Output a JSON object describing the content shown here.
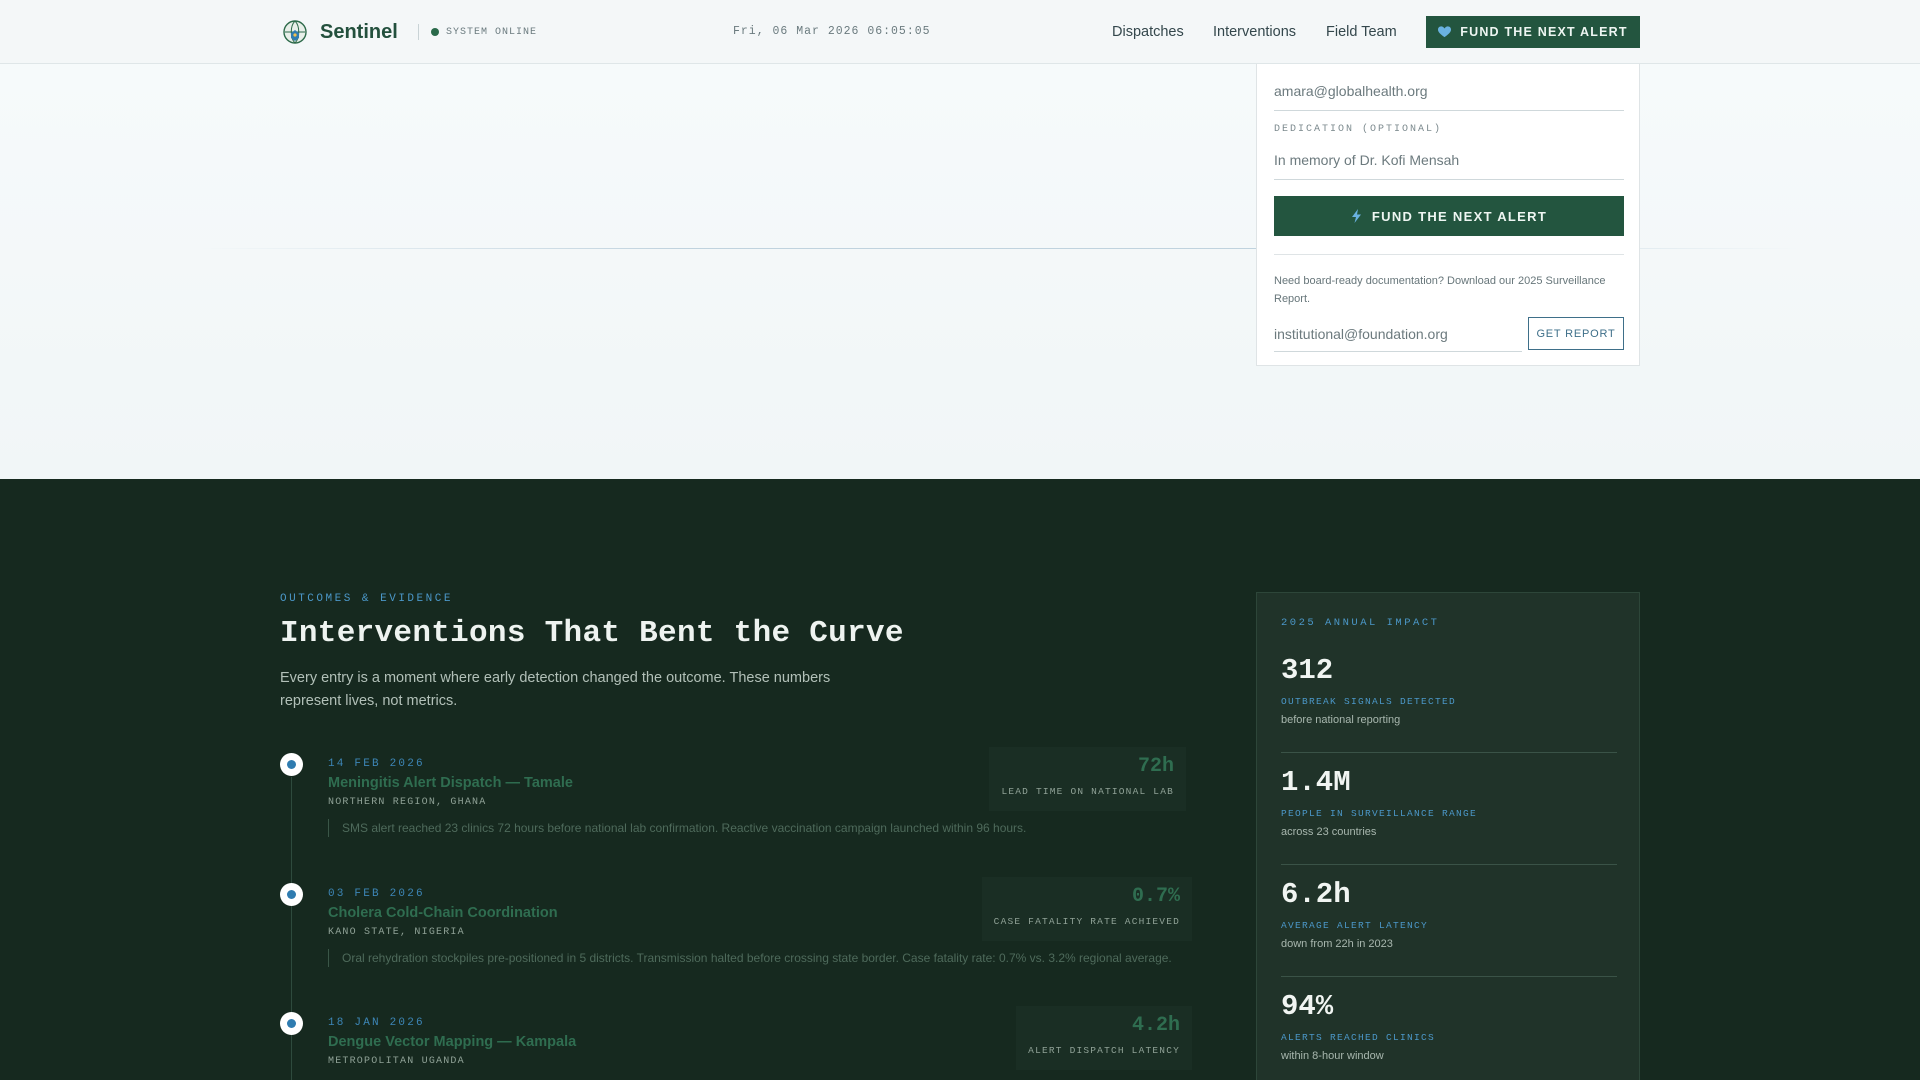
{
  "header": {
    "brand": "Sentinel",
    "status": "SYSTEM ONLINE",
    "clock": "Fri, 06 Mar 2026 06:05:05",
    "nav": [
      "Dispatches",
      "Interventions",
      "Field Team"
    ],
    "cta_label": "FUND THE NEXT ALERT"
  },
  "donation_form": {
    "email_value": "amara@globalhealth.org",
    "dedication_label": "DEDICATION (OPTIONAL)",
    "dedication_value": "In memory of Dr. Kofi Mensah",
    "submit_label": "FUND THE NEXT ALERT",
    "report_note": "Need board-ready documentation? Download our 2025 Surveillance Report.",
    "report_email_value": "institutional@foundation.org",
    "report_button": "GET REPORT"
  },
  "outcomes": {
    "eyebrow": "OUTCOMES & EVIDENCE",
    "title": "Interventions That Bent the Curve",
    "description": "Every entry is a moment where early detection changed the outcome. These numbers represent lives, not metrics.",
    "timeline": [
      {
        "date": "14 FEB 2026",
        "title": "Meningitis Alert Dispatch — Tamale",
        "region": "NORTHERN REGION, GHANA",
        "note": "SMS alert reached 23 clinics 72 hours before national lab confirmation. Reactive vaccination campaign launched within 96 hours.",
        "stat_value": "72h",
        "stat_label": "LEAD TIME ON NATIONAL LAB"
      },
      {
        "date": "03 FEB 2026",
        "title": "Cholera Cold-Chain Coordination",
        "region": "KANO STATE, NIGERIA",
        "note": "Oral rehydration stockpiles pre-positioned in 5 districts. Transmission halted before crossing state border. Case fatality rate: 0.7% vs. 3.2% regional average.",
        "stat_value": "0.7%",
        "stat_label": "CASE FATALITY RATE ACHIEVED"
      },
      {
        "date": "18 JAN 2026",
        "title": "Dengue Vector Mapping — Kampala",
        "region": "METROPOLITAN UGANDA",
        "note": "",
        "stat_value": "4.2h",
        "stat_label": "ALERT DISPATCH LATENCY"
      }
    ]
  },
  "impact": {
    "eyebrow": "2025 ANNUAL IMPACT",
    "metrics": [
      {
        "value": "312",
        "label": "OUTBREAK SIGNALS DETECTED",
        "sub": "before national reporting"
      },
      {
        "value": "1.4M",
        "label": "PEOPLE IN SURVEILLANCE RANGE",
        "sub": "across 23 countries"
      },
      {
        "value": "6.2h",
        "label": "AVERAGE ALERT LATENCY",
        "sub": "down from 22h in 2023"
      },
      {
        "value": "94%",
        "label": "ALERTS REACHED CLINICS",
        "sub": "within 8-hour window"
      }
    ]
  },
  "colors": {
    "brand_green": "#23553f",
    "accent_blue": "#4b97c8",
    "dark_bg": "#16291f",
    "status_online": "#2a6a4a"
  },
  "icons": {
    "logo": "globe-shield-icon",
    "status": "status-dot-icon",
    "cta": "heart-icon",
    "submit": "lightning-bolt-icon"
  }
}
